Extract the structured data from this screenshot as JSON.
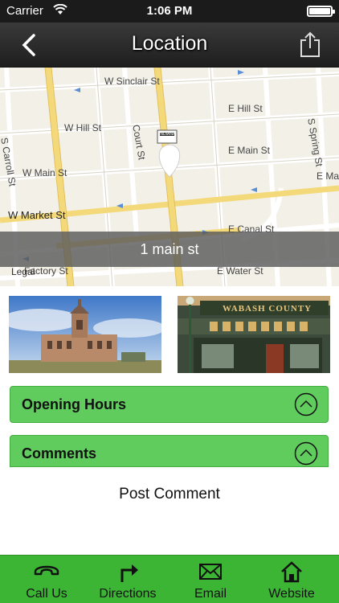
{
  "status_bar": {
    "carrier": "Carrier",
    "time": "1:06 PM"
  },
  "nav": {
    "title": "Location",
    "back_icon": "chevron-left-icon",
    "share_icon": "share-icon"
  },
  "map": {
    "streets": {
      "w_sinclair": "W Sinclair St",
      "e_hill": "E Hill St",
      "s_spring": "S Spring St",
      "w_hill": "W Hill St",
      "court": "Court St",
      "s_carroll": "S Carroll St",
      "e_main": "E Main St",
      "w_main": "W Main St",
      "e_mark": "E Mark",
      "w_market": "W Market St",
      "e_canal": "E Canal St",
      "e_water": "E Water St",
      "factory": "Factory St"
    },
    "pin_shield": "INDIANA",
    "address": "1 main st",
    "legal": "Legal"
  },
  "photos": {
    "building_alt": "courthouse-photo",
    "store_sign": "WABASH COUNTY"
  },
  "sections": {
    "hours_label": "Opening Hours",
    "comments_label": "Comments"
  },
  "post_comment": "Post Comment",
  "tabs": {
    "call": "Call Us",
    "directions": "Directions",
    "email": "Email",
    "website": "Website"
  },
  "colors": {
    "accent_green": "#5fcc5d",
    "tab_green": "#3cb534",
    "nav_dark": "#2a2a2a"
  }
}
